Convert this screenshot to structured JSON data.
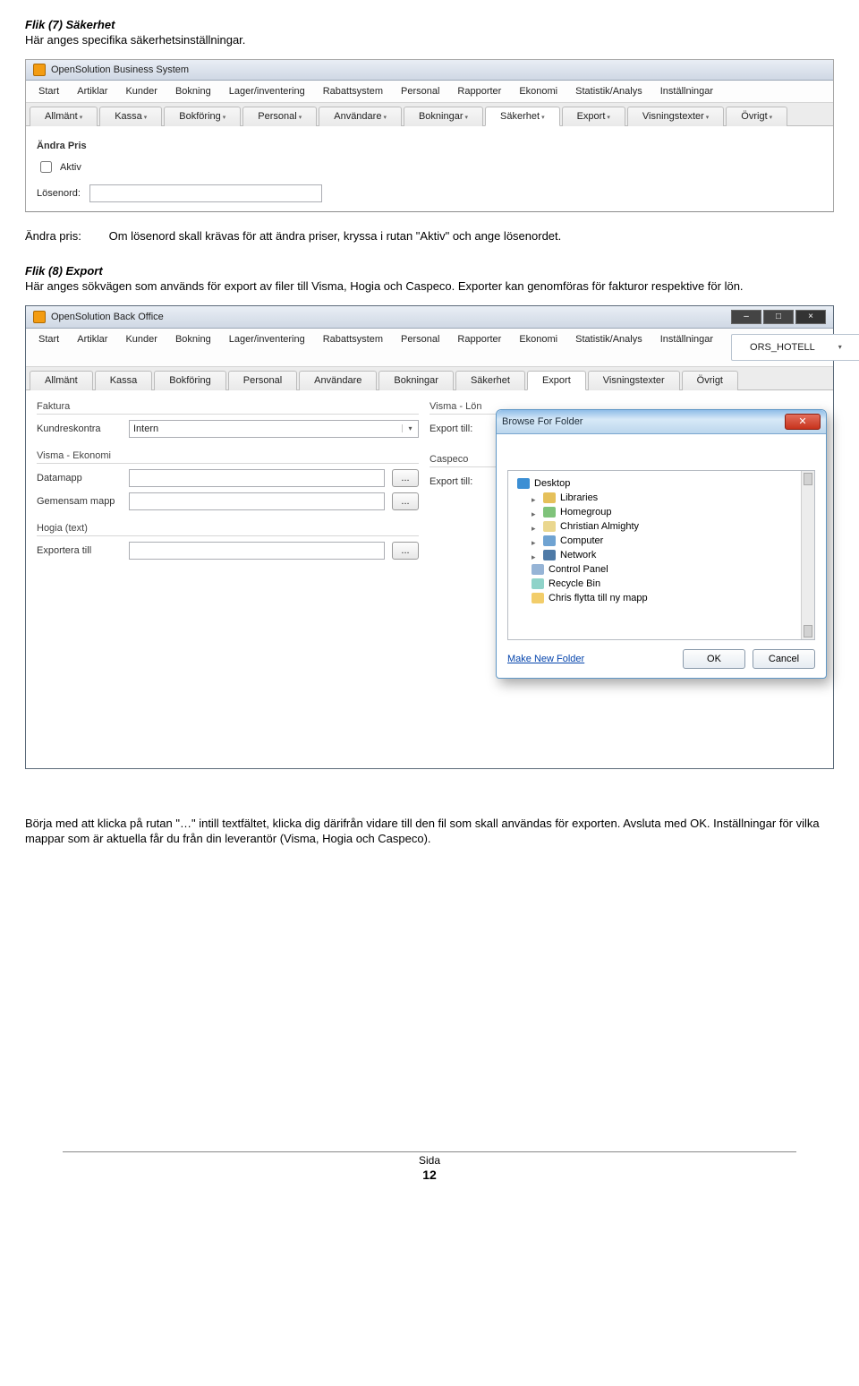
{
  "doc": {
    "s7_title": "Flik (7) Säkerhet",
    "s7_sub": "Här anges specifika säkerhetsinställningar.",
    "andra_pris_label": "Ändra pris:",
    "andra_pris_text": "Om lösenord skall krävas för att ändra priser, kryssa i rutan \"Aktiv\" och ange lösenordet.",
    "s8_title": "Flik (8) Export",
    "s8_sub": "Här anges sökvägen som används för export av filer till Visma, Hogia och Caspeco. Exporter kan genomföras för fakturor respektive för lön.",
    "foot_text": "Börja med att klicka på rutan \"…\" intill textfältet, klicka dig därifrån vidare till den fil som skall användas för exporten. Avsluta med OK. Inställningar för vilka mappar som är aktuella får du från din leverantör (Visma, Hogia och Caspeco).",
    "page_label": "Sida",
    "page_number": "12"
  },
  "menu": {
    "items": [
      "Start",
      "Artiklar",
      "Kunder",
      "Bokning",
      "Lager/inventering",
      "Rabattsystem",
      "Personal",
      "Rapporter",
      "Ekonomi",
      "Statistik/Analys",
      "Inställningar"
    ]
  },
  "subtabs": {
    "items": [
      "Allmänt",
      "Kassa",
      "Bokföring",
      "Personal",
      "Användare",
      "Bokningar",
      "Säkerhet",
      "Export",
      "Visningstexter",
      "Övrigt"
    ]
  },
  "screenshot1": {
    "app_title": "OpenSolution Business System",
    "active_tab": "Säkerhet",
    "group_label": "Ändra Pris",
    "chk_label": "Aktiv",
    "password_label": "Lösenord:",
    "password_value": ""
  },
  "screenshot2": {
    "app_title": "OpenSolution Back Office",
    "db_selector": "ORS_HOTELL",
    "active_tab": "Export",
    "faktura": {
      "legend": "Faktura",
      "kundreskontra_label": "Kundreskontra",
      "kundreskontra_value": "Intern"
    },
    "visma_ekonomi": {
      "legend": "Visma - Ekonomi",
      "datamapp_label": "Datamapp",
      "datamapp_value": "",
      "gemensam_label": "Gemensam mapp",
      "gemensam_value": ""
    },
    "hogia": {
      "legend": "Hogia (text)",
      "export_label": "Exportera till",
      "export_value": ""
    },
    "visma_lon": {
      "legend": "Visma - Lön",
      "export_label": "Export till:",
      "export_value": ""
    },
    "caspeco": {
      "legend": "Caspeco",
      "export_label": "Export till:",
      "export_value": ""
    },
    "dots": "..."
  },
  "bff": {
    "title": "Browse For Folder",
    "items": [
      "Desktop",
      "Libraries",
      "Homegroup",
      "Christian Almighty",
      "Computer",
      "Network",
      "Control Panel",
      "Recycle Bin",
      "Chris flytta till ny mapp"
    ],
    "make_new": "Make New Folder",
    "ok": "OK",
    "cancel": "Cancel"
  }
}
